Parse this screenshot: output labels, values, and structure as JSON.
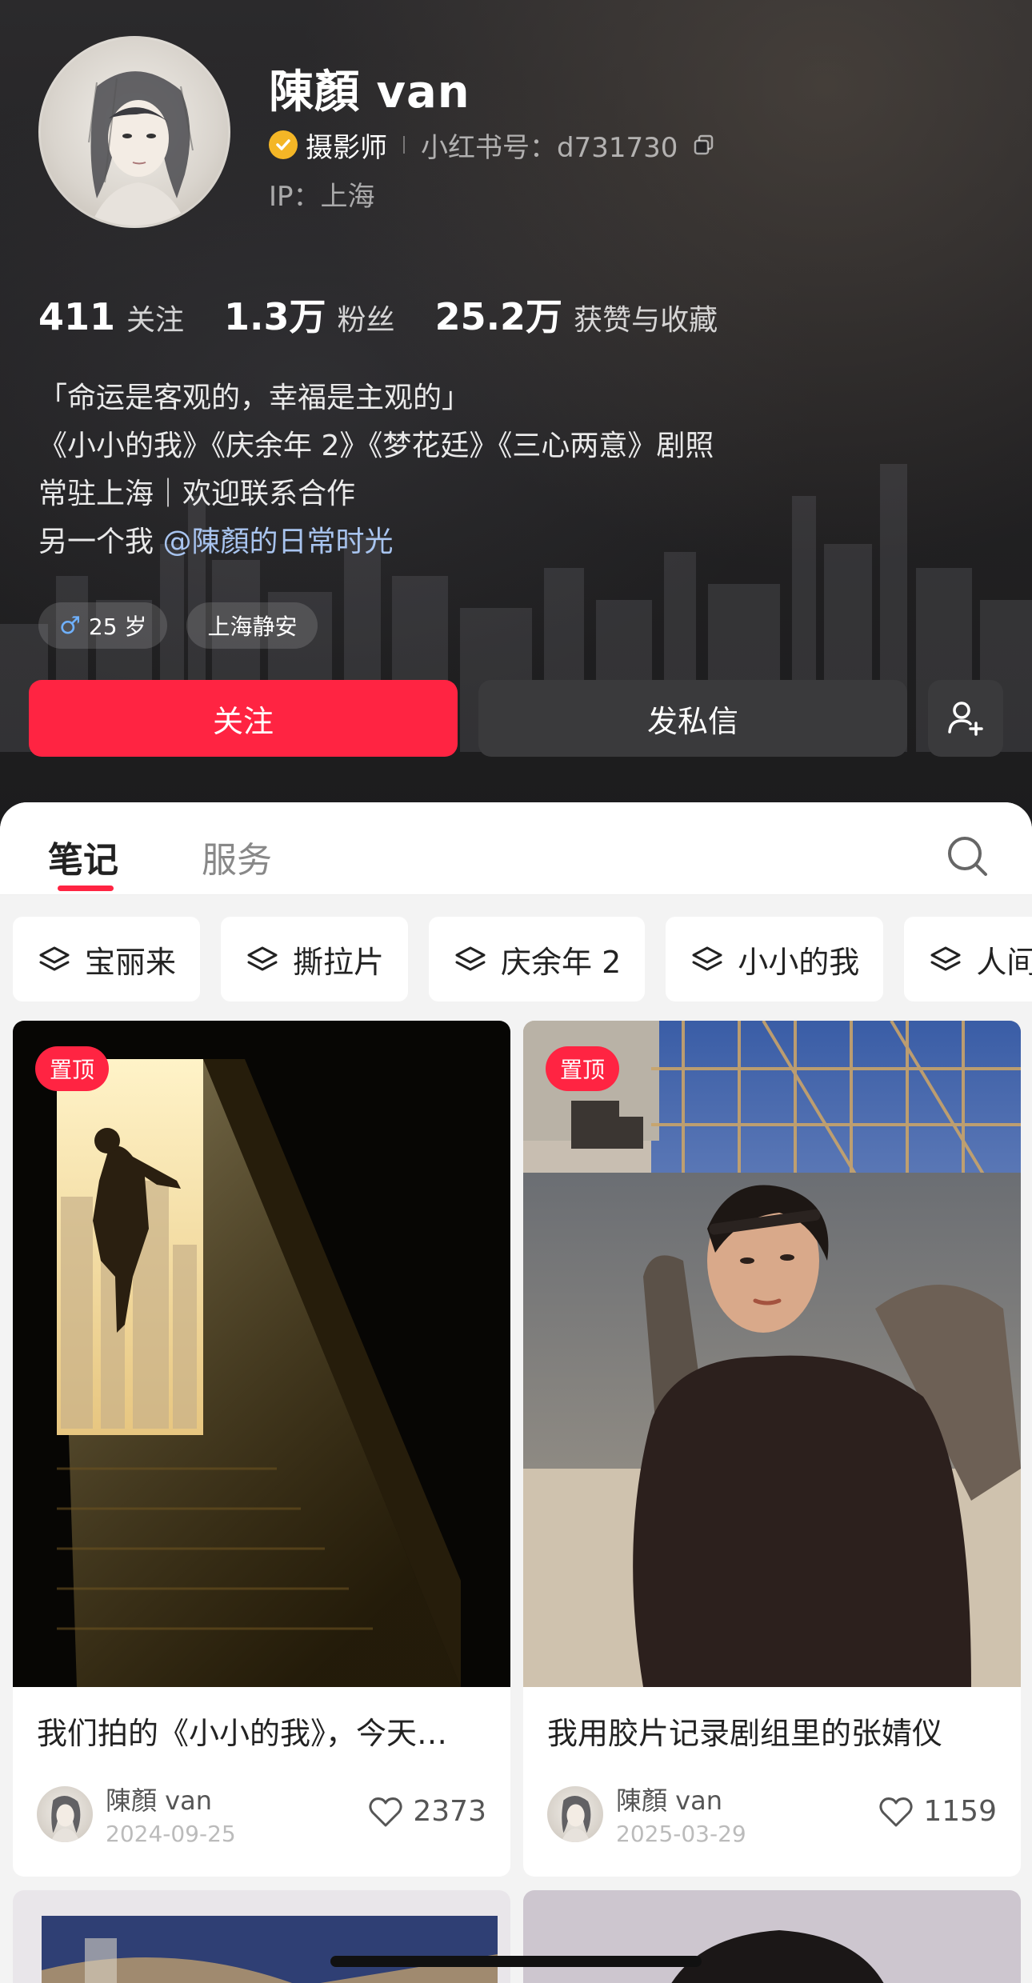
{
  "profile": {
    "name": "陳顏 van",
    "role": "摄影师",
    "rednote_id": "小红书号：d731730",
    "ip": "IP：上海"
  },
  "stats": [
    {
      "num": "411",
      "label": "关注"
    },
    {
      "num": "1.3万",
      "label": "粉丝"
    },
    {
      "num": "25.2万",
      "label": "获赞与收藏"
    }
  ],
  "bio": {
    "line1": "「命运是客观的，幸福是主观的」",
    "line2": "《小小的我》《庆余年 2》《梦花廷》《三心两意》剧照",
    "line3": "常驻上海｜欢迎联系合作",
    "line4_prefix": "另一个我 ",
    "line4_mention": "@陳顏的日常时光"
  },
  "tags": {
    "age": "25 岁",
    "location": "上海静安"
  },
  "actions": {
    "follow": "关注",
    "message": "发私信"
  },
  "tabs": {
    "notes": "笔记",
    "service": "服务"
  },
  "chips": [
    "宝丽来",
    "撕拉片",
    "庆余年 2",
    "小小的我",
    "人间"
  ],
  "posts": [
    {
      "pin": "置顶",
      "title": "我们拍的《小小的我》，今天…",
      "author": "陳顏 van",
      "date": "2024-09-25",
      "likes": "2373"
    },
    {
      "pin": "置顶",
      "title": "我用胶片记录剧组里的张婧仪",
      "author": "陳顏 van",
      "date": "2025-03-29",
      "likes": "1159"
    }
  ],
  "colors": {
    "accent": "#ff2442",
    "verified": "#f4b626",
    "mention": "#a8c4ef"
  }
}
